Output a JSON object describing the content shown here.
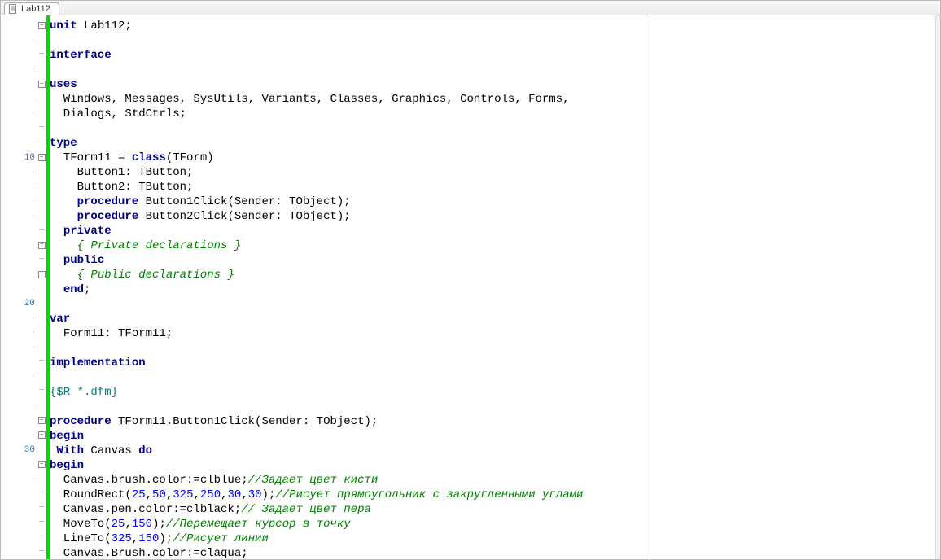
{
  "tab": {
    "label": "Lab112"
  },
  "gutter": {
    "rows": [
      {
        "fold": "minus"
      },
      {
        "dot": true
      },
      {
        "dash": true
      },
      {
        "dot": true
      },
      {
        "fold": "minus"
      },
      {
        "dot": true
      },
      {
        "dot": true
      },
      {
        "dash": true
      },
      {
        "dot": true
      },
      {
        "num": "10",
        "fold": "minus"
      },
      {
        "dot": true
      },
      {
        "dot": true
      },
      {
        "dot": true
      },
      {
        "dot": true
      },
      {
        "dash": true
      },
      {
        "dot": true,
        "fold": "minus"
      },
      {
        "dash": true
      },
      {
        "dot": true,
        "fold": "minus"
      },
      {
        "dot": true
      },
      {
        "num": "20"
      },
      {
        "dot": true
      },
      {
        "dot": true
      },
      {
        "dot": true
      },
      {
        "dash": true
      },
      {
        "dot": true
      },
      {
        "dash": true
      },
      {
        "dot": true
      },
      {
        "fold": "minus"
      },
      {
        "dot": true,
        "fold": "minus"
      },
      {
        "num": "30"
      },
      {
        "dot": true,
        "fold": "minus"
      },
      {
        "dot": true
      },
      {
        "dash": true
      },
      {
        "dash": true
      },
      {
        "dash": true
      },
      {
        "dash": true
      },
      {
        "dash": true
      }
    ]
  },
  "code": [
    [
      {
        "t": "kw",
        "v": "unit"
      },
      {
        "t": "plain",
        "v": " Lab112;"
      }
    ],
    [],
    [
      {
        "t": "kw",
        "v": "interface"
      }
    ],
    [],
    [
      {
        "t": "kw",
        "v": "uses"
      }
    ],
    [
      {
        "t": "plain",
        "v": "  Windows, Messages, SysUtils, Variants, Classes, Graphics, Controls, Forms,"
      }
    ],
    [
      {
        "t": "plain",
        "v": "  Dialogs, StdCtrls;"
      }
    ],
    [],
    [
      {
        "t": "kw",
        "v": "type"
      }
    ],
    [
      {
        "t": "plain",
        "v": "  TForm11 = "
      },
      {
        "t": "kw",
        "v": "class"
      },
      {
        "t": "plain",
        "v": "(TForm)"
      }
    ],
    [
      {
        "t": "plain",
        "v": "    Button1: TButton;"
      }
    ],
    [
      {
        "t": "plain",
        "v": "    Button2: TButton;"
      }
    ],
    [
      {
        "t": "plain",
        "v": "    "
      },
      {
        "t": "kw",
        "v": "procedure"
      },
      {
        "t": "plain",
        "v": " Button1Click(Sender: TObject);"
      }
    ],
    [
      {
        "t": "plain",
        "v": "    "
      },
      {
        "t": "kw",
        "v": "procedure"
      },
      {
        "t": "plain",
        "v": " Button2Click(Sender: TObject);"
      }
    ],
    [
      {
        "t": "plain",
        "v": "  "
      },
      {
        "t": "kw",
        "v": "private"
      }
    ],
    [
      {
        "t": "plain",
        "v": "    "
      },
      {
        "t": "cmt",
        "v": "{ Private declarations }"
      }
    ],
    [
      {
        "t": "plain",
        "v": "  "
      },
      {
        "t": "kw",
        "v": "public"
      }
    ],
    [
      {
        "t": "plain",
        "v": "    "
      },
      {
        "t": "cmt",
        "v": "{ Public declarations }"
      }
    ],
    [
      {
        "t": "plain",
        "v": "  "
      },
      {
        "t": "kw",
        "v": "end"
      },
      {
        "t": "plain",
        "v": ";"
      }
    ],
    [],
    [
      {
        "t": "kw",
        "v": "var"
      }
    ],
    [
      {
        "t": "plain",
        "v": "  Form11: TForm11;"
      }
    ],
    [],
    [
      {
        "t": "kw",
        "v": "implementation"
      }
    ],
    [],
    [
      {
        "t": "dir",
        "v": "{$R *.dfm}"
      }
    ],
    [],
    [
      {
        "t": "kw",
        "v": "procedure"
      },
      {
        "t": "plain",
        "v": " TForm11.Button1Click(Sender: TObject);"
      }
    ],
    [
      {
        "t": "kw",
        "v": "begin"
      }
    ],
    [
      {
        "t": "plain",
        "v": " "
      },
      {
        "t": "kw",
        "v": "With"
      },
      {
        "t": "plain",
        "v": " Canvas "
      },
      {
        "t": "kw",
        "v": "do"
      }
    ],
    [
      {
        "t": "kw",
        "v": "begin"
      }
    ],
    [
      {
        "t": "plain",
        "v": "  Canvas.brush.color:=clblue;"
      },
      {
        "t": "cmt",
        "v": "//Задает цвет кисти"
      }
    ],
    [
      {
        "t": "plain",
        "v": "  RoundRect("
      },
      {
        "t": "num",
        "v": "25"
      },
      {
        "t": "plain",
        "v": ","
      },
      {
        "t": "num",
        "v": "50"
      },
      {
        "t": "plain",
        "v": ","
      },
      {
        "t": "num",
        "v": "325"
      },
      {
        "t": "plain",
        "v": ","
      },
      {
        "t": "num",
        "v": "250"
      },
      {
        "t": "plain",
        "v": ","
      },
      {
        "t": "num",
        "v": "30"
      },
      {
        "t": "plain",
        "v": ","
      },
      {
        "t": "num",
        "v": "30"
      },
      {
        "t": "plain",
        "v": ");"
      },
      {
        "t": "cmt",
        "v": "//Рисует прямоугольник с закругленными углами"
      }
    ],
    [
      {
        "t": "plain",
        "v": "  Canvas.pen.color:=clblack;"
      },
      {
        "t": "cmt",
        "v": "// Задает цвет пера"
      }
    ],
    [
      {
        "t": "plain",
        "v": "  MoveTo("
      },
      {
        "t": "num",
        "v": "25"
      },
      {
        "t": "plain",
        "v": ","
      },
      {
        "t": "num",
        "v": "150"
      },
      {
        "t": "plain",
        "v": ");"
      },
      {
        "t": "cmt",
        "v": "//Перемещает курсор в точку"
      }
    ],
    [
      {
        "t": "plain",
        "v": "  LineTo("
      },
      {
        "t": "num",
        "v": "325"
      },
      {
        "t": "plain",
        "v": ","
      },
      {
        "t": "num",
        "v": "150"
      },
      {
        "t": "plain",
        "v": ");"
      },
      {
        "t": "cmt",
        "v": "//Рисует линии"
      }
    ],
    [
      {
        "t": "plain",
        "v": "  Canvas.Brush.color:=claqua;"
      }
    ]
  ]
}
